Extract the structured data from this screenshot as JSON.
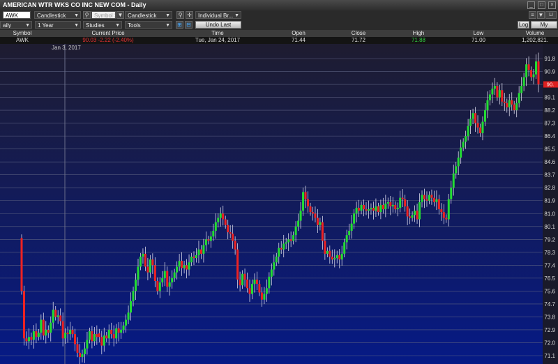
{
  "window": {
    "title": "AMERICAN WTR WKS CO INC NEW COM - Daily"
  },
  "toolbar1": {
    "symbol_input": "AWK",
    "chart_type": "Candlestick",
    "symbol2_placeholder": "Symbol 2",
    "chart_type2": "Candlestick",
    "broker": "Individual Br...",
    "right_label": "Li"
  },
  "toolbar2": {
    "interval": "aily",
    "range": "1 Year",
    "studies": "Studies",
    "tools": "Tools",
    "undo": "Undo Last",
    "log": "Log",
    "my_charts": "My Charts"
  },
  "quote": {
    "headers": [
      "Symbol",
      "Current Price",
      "Time",
      "Open",
      "Close",
      "High",
      "Low",
      "Volume"
    ],
    "symbol": "AWK",
    "current_price": "90.03 -2.22 (-2.40%)",
    "time": "Tue, Jan 24, 2017",
    "open": "71.44",
    "close": "71.72",
    "high": "71.88",
    "low": "71.00",
    "volume": "1,202,821."
  },
  "chart_data": {
    "type": "candlestick",
    "date_label": "Jan 3, 2017",
    "y_ticks": [
      71.1,
      72.0,
      72.9,
      73.8,
      74.7,
      75.6,
      76.5,
      77.4,
      78.3,
      79.2,
      80.1,
      81.0,
      81.9,
      82.8,
      83.7,
      84.6,
      85.5,
      86.4,
      87.3,
      88.2,
      89.1,
      90.0,
      90.9,
      91.8
    ],
    "last_price_label": "90.",
    "colors": {
      "up": "#22dd33",
      "down": "#ee2222",
      "bg_top": "#1e1c30",
      "bg_bottom": "#061a86",
      "grid": "#5a5f80"
    },
    "closes": [
      75.6,
      72.3,
      72.1,
      72.4,
      72.2,
      72.8,
      72.4,
      72.7,
      73.6,
      72.5,
      72.9,
      72.7,
      73.4,
      74.3,
      73.8,
      73.9,
      73.5,
      72.3,
      72.7,
      72.6,
      72.9,
      72.6,
      71.9,
      71.3,
      71.0,
      71.2,
      71.6,
      72.2,
      72.8,
      72.1,
      72.6,
      72.4,
      72.4,
      71.8,
      72.5,
      72.3,
      72.9,
      72.6,
      72.3,
      73.0,
      72.7,
      72.9,
      73.2,
      73.6,
      74.1,
      74.9,
      75.6,
      76.4,
      77.3,
      78.0,
      78.2,
      77.3,
      76.9,
      77.8,
      77.4,
      76.3,
      75.6,
      76.2,
      76.5,
      77.0,
      75.9,
      76.2,
      76.5,
      76.9,
      77.3,
      77.7,
      77.2,
      77.4,
      77.1,
      77.6,
      78.0,
      77.9,
      78.1,
      78.5,
      78.2,
      78.8,
      79.2,
      79.1,
      79.4,
      79.8,
      80.4,
      80.7,
      81.0,
      80.6,
      80.2,
      79.7,
      79.6,
      79.1,
      78.5,
      76.4,
      76.0,
      76.8,
      76.4,
      75.8,
      75.4,
      76.1,
      76.4,
      76.1,
      75.5,
      75.0,
      75.4,
      75.8,
      76.6,
      77.1,
      77.6,
      78.0,
      78.6,
      78.5,
      78.9,
      79.0,
      79.2,
      79.1,
      79.5,
      80.1,
      80.5,
      81.2,
      82.5,
      82.0,
      81.5,
      81.1,
      81.0,
      80.7,
      80.2,
      80.4,
      79.1,
      78.2,
      78.4,
      78.0,
      77.8,
      77.9,
      78.1,
      77.8,
      78.2,
      79.0,
      79.5,
      79.8,
      80.3,
      81.0,
      81.4,
      81.2,
      81.6,
      81.3,
      81.2,
      81.3,
      81.4,
      81.2,
      81.5,
      81.1,
      81.6,
      81.3,
      81.7,
      81.8,
      81.5,
      81.6,
      81.3,
      81.4,
      82.1,
      82.0,
      81.5,
      80.8,
      80.7,
      80.9,
      81.2,
      80.6,
      81.8,
      82.3,
      82.0,
      81.9,
      82.3,
      82.1,
      81.8,
      82.0,
      81.3,
      81.1,
      80.7,
      80.6,
      82.0,
      82.8,
      83.8,
      84.3,
      84.9,
      85.6,
      86.0,
      86.4,
      87.1,
      87.6,
      88.0,
      87.3,
      87.0,
      86.6,
      87.4,
      88.2,
      88.9,
      89.3,
      89.7,
      89.9,
      89.1,
      89.6,
      88.8,
      88.7,
      88.4,
      88.9,
      88.6,
      88.2,
      88.7,
      89.4,
      89.9,
      90.5,
      91.4,
      91.0,
      90.5,
      90.7,
      91.6,
      90.0
    ]
  }
}
